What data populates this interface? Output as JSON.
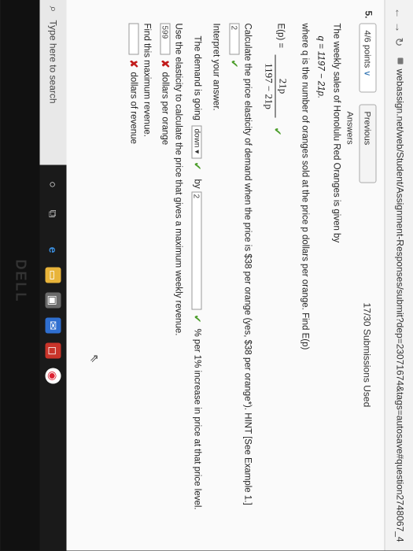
{
  "browser": {
    "url": "webassign.net/web/Student/Assignment-Responses/submit?dep=23071674&tags=autosave#question2748067_4"
  },
  "question": {
    "number": "5.",
    "points_label": "4/6 points",
    "previous_answers_label": "Previous Answers",
    "submissions": "17/30 Submissions Used",
    "intro": "The weekly sales of Honolulu Red Oranges is given by",
    "equation": "q = 1197 − 21p.",
    "where": "where q is the number of oranges sold at the price p dollars per orange. Find E(p)",
    "ep_label": "E(p) =",
    "ep_numerator": "21p",
    "ep_denominator": "1197 − 21p",
    "calc_prompt": "Calculate the price elasticity of demand when the price is $38 per orange (yes, $38 per orange*). HINT [See Example 1.]",
    "calc_answer": "2",
    "interpret_label": "Interpret your answer.",
    "demand_prefix": "The demand is going",
    "demand_select": "down",
    "by_label": "by",
    "by_value": "2",
    "demand_suffix": "% per 1% increase in price at that price level.",
    "elasticity_prompt": "Use the elasticity to calculate the price that gives a maximum weekly revenue.",
    "price_answer": "599",
    "price_unit": "dollars per orange",
    "revenue_prompt": "Find this maximum revenue.",
    "revenue_answer": "",
    "revenue_unit": "dollars of revenue"
  },
  "taskbar": {
    "search_placeholder": "Type here to search"
  },
  "colors": {
    "correct": "#4b9d2a",
    "incorrect": "#c21b1b"
  }
}
